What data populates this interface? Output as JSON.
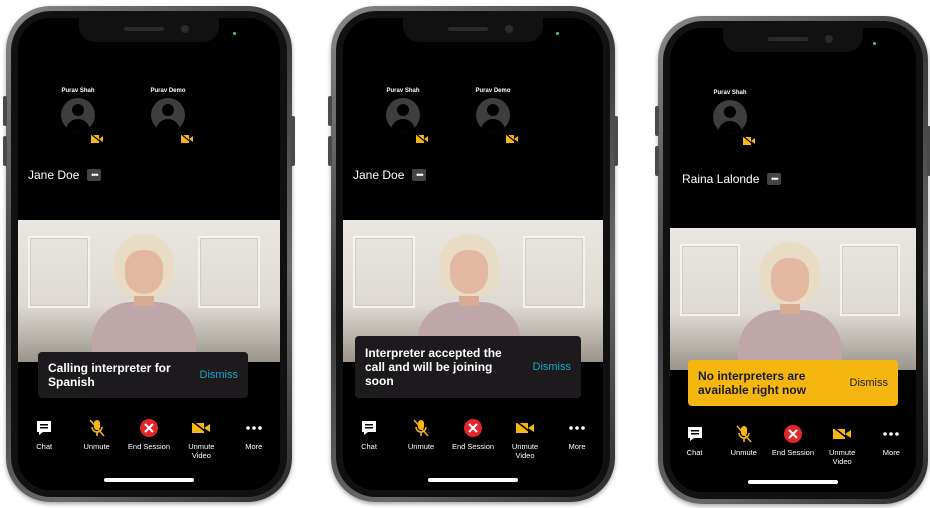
{
  "phones": [
    {
      "participants": [
        "Purav Shah",
        "Purav Demo"
      ],
      "active_name": "Jane Doe",
      "banner": {
        "message": "Calling interpreter for Spanish",
        "dismiss": "Dismiss"
      }
    },
    {
      "participants": [
        "Purav Shah",
        "Purav Demo"
      ],
      "active_name": "Jane Doe",
      "banner": {
        "message": "Interpreter accepted the call and will be joining soon",
        "dismiss": "Dismiss"
      }
    },
    {
      "participants": [
        "Purav Shah"
      ],
      "active_name": "Raina Lalonde",
      "banner": {
        "message": "No interpreters are available right now",
        "dismiss": "Dismiss"
      }
    }
  ],
  "toolbar": {
    "chat": "Chat",
    "unmute": "Unmute",
    "end_session": "End Session",
    "unmute_video": "Unmute Video",
    "more": "More"
  },
  "icons": {
    "chat": "chat-icon",
    "unmute": "mic-off-icon",
    "end_session": "close-circle-icon",
    "unmute_video": "video-off-icon",
    "more": "ellipsis-icon"
  },
  "colors": {
    "accent_yellow": "#f5b70f",
    "dismiss_blue": "#19a7c9",
    "end_red": "#e4262c",
    "banner_dark": "#1d1a1e"
  }
}
